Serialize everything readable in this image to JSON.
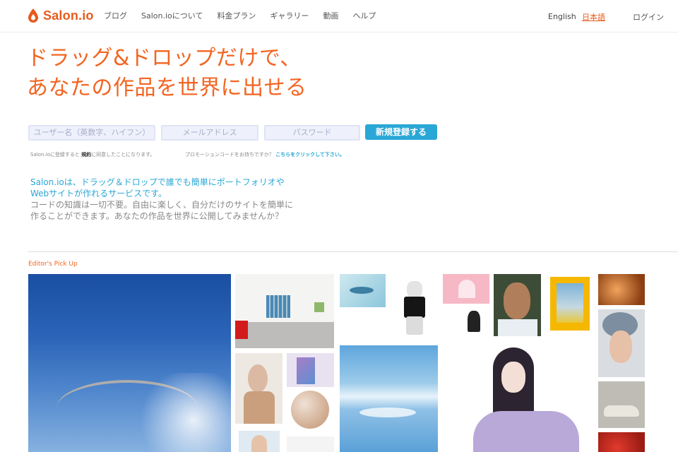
{
  "header": {
    "logo_text": "Salon.io",
    "nav": [
      "ブログ",
      "Salon.ioについて",
      "料金プラン",
      "ギャラリー",
      "動画",
      "ヘルプ"
    ],
    "lang_en": "English",
    "lang_ja": "日本語",
    "login": "ログイン"
  },
  "hero": {
    "line1": "ドラッグ&ドロップだけで、",
    "line2": "あなたの作品を世界に出せる"
  },
  "signup": {
    "username_placeholder": "ユーザー名（英数字、ハイフン）",
    "email_placeholder": "メールアドレス",
    "password_placeholder": "パスワード",
    "button": "新規登録する",
    "terms_prefix": "Salon.ioに登録すると",
    "terms_link": "規約",
    "terms_suffix": "に同意したことになります。",
    "promo_prefix": "プロモーションコードをお持ちですか？",
    "promo_link": "こちらをクリックして下さい。"
  },
  "intro": {
    "blue_line1": "Salon.ioは、ドラッグ＆ドロップで誰でも簡単にポートフォリオや",
    "blue_line2": "Webサイトが作れるサービスです。",
    "gray_line1": "コードの知識は一切不要。自由に楽しく、自分だけのサイトを簡単に",
    "gray_line2": "作ることができます。あなたの作品を世界に公開してみませんか？"
  },
  "picks": {
    "title": "Editor's Pick Up"
  },
  "colors": {
    "brand_orange": "#f26522",
    "accent_blue": "#2aa7d6"
  }
}
